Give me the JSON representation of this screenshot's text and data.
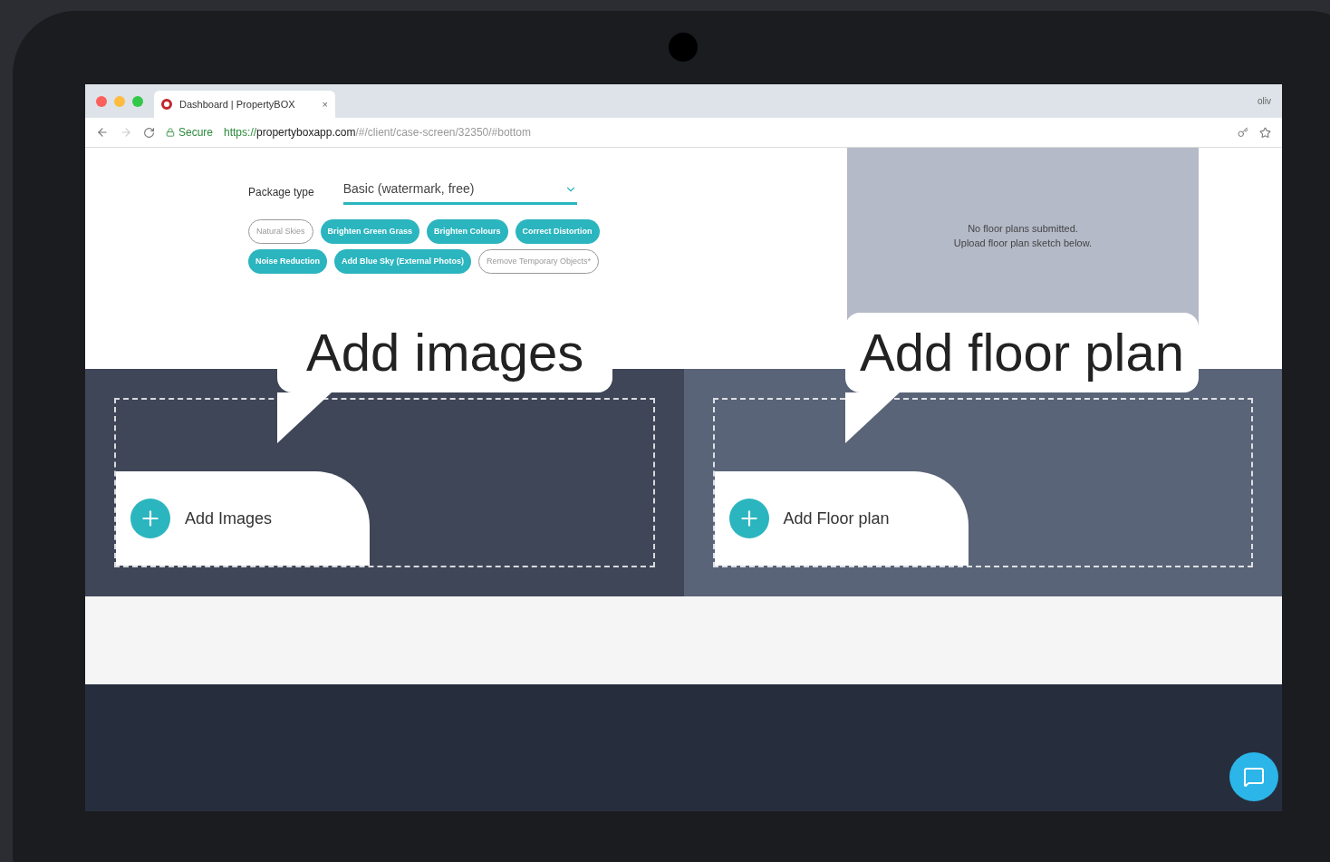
{
  "browser": {
    "tab_title": "Dashboard | PropertyBOX",
    "tab_close": "×",
    "secure_label": "Secure",
    "url_scheme": "https://",
    "url_host": "propertyboxapp.com",
    "url_path": "/#/client/case-screen/32350/#bottom",
    "profile": "oliv"
  },
  "package": {
    "label": "Package type",
    "value": "Basic (watermark, free)"
  },
  "options": [
    {
      "label": "Natural Skies",
      "selected": false
    },
    {
      "label": "Brighten Green Grass",
      "selected": true
    },
    {
      "label": "Brighten Colours",
      "selected": true
    },
    {
      "label": "Correct Distortion",
      "selected": true
    },
    {
      "label": "Noise Reduction",
      "selected": true
    },
    {
      "label": "Add Blue Sky (External Photos)",
      "selected": true
    },
    {
      "label": "Remove Temporary Objects*",
      "selected": false
    }
  ],
  "floor_plan_preview": {
    "message_1": "No floor plans submitted.",
    "message_2": "Upload floor plan sketch below."
  },
  "upload_panels": [
    {
      "label": "Add Images",
      "callout": "Add images"
    },
    {
      "label": "Add Floor plan",
      "callout": "Add floor plan"
    }
  ]
}
